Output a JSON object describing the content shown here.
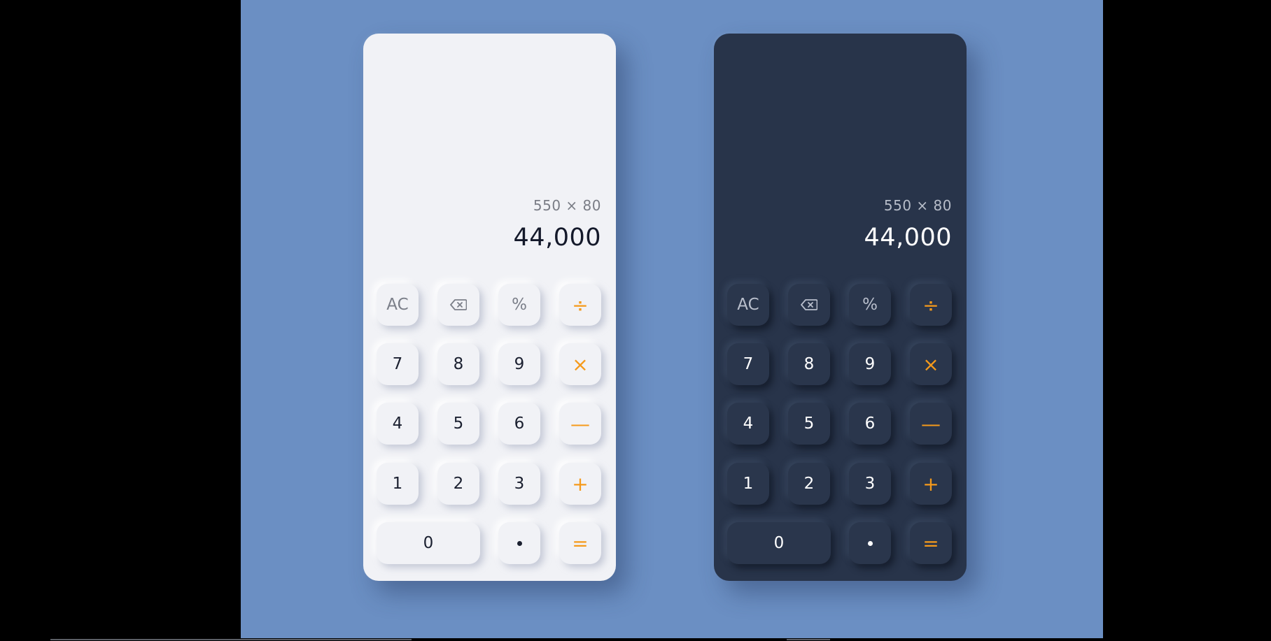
{
  "colors": {
    "background": "#6b8fc3",
    "light_panel": "#f1f2f6",
    "dark_panel": "#28344a",
    "operator_accent": "#f59a1b"
  },
  "light_calculator": {
    "expression": "550 × 80",
    "result": "44,000"
  },
  "dark_calculator": {
    "expression": "550 × 80",
    "result": "44,000"
  },
  "keys": {
    "clear": "AC",
    "backspace_icon": "backspace-icon",
    "percent": "%",
    "divide": "÷",
    "seven": "7",
    "eight": "8",
    "nine": "9",
    "multiply": "×",
    "four": "4",
    "five": "5",
    "six": "6",
    "minus": "—",
    "one": "1",
    "two": "2",
    "three": "3",
    "plus": "+",
    "zero": "0",
    "decimal_icon": "decimal-point-icon",
    "equals": "="
  }
}
